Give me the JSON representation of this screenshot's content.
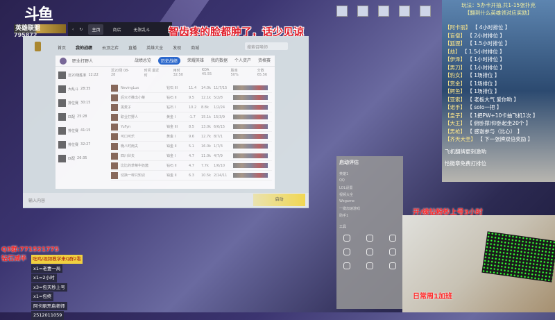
{
  "stream": {
    "platform_logo": "斗鱼",
    "game_banner": "英雄联盟",
    "room_id": "795872",
    "caption": "智齿疼的脸都肿了，话少见谅"
  },
  "client_topbar": {
    "tabs": [
      "主页",
      "商店",
      "无限乱斗"
    ]
  },
  "client": {
    "nav": [
      "首页",
      "我的战绩",
      "云顶之弈",
      "直播",
      "英雄大全",
      "发现",
      "商城"
    ],
    "search_placeholder": "搜索召唤师",
    "profile": {
      "name": "职业打野人",
      "tabs": [
        "战绩总览",
        "历史战绩",
        "荣耀英雄",
        "我的数据",
        "个人资产",
        "资格赛"
      ],
      "summary": [
        "近20场 08-28",
        "时间 最近时",
        "用时 32:50",
        "KDA 45.55",
        "胜率 50%",
        "分数 65.56"
      ],
      "left_list": [
        {
          "label": "近20场胜率",
          "time": "12:22"
        },
        {
          "label": "大乱斗",
          "time": "28:35"
        },
        {
          "label": "排位赛",
          "time": "30:15"
        },
        {
          "label": "匹配",
          "time": "25:28"
        },
        {
          "label": "排位赛",
          "time": "41:15"
        },
        {
          "label": "排位赛",
          "time": "32:27"
        },
        {
          "label": "匹配",
          "time": "26:35"
        }
      ],
      "rows": [
        {
          "name": "NevingLux",
          "rank": "钻石 III",
          "score": "11.4",
          "gold": "14.0k",
          "kda": "11/7/15"
        },
        {
          "name": "后只才推出小菜",
          "rank": "钻石 II",
          "score": "9.5",
          "gold": "12.1k",
          "kda": "5/2/8"
        },
        {
          "name": "黑麦子",
          "rank": "钻石 I",
          "score": "10.2",
          "gold": "8.8k",
          "kda": "1/2/24"
        },
        {
          "name": "职业打野人",
          "rank": "黄金 I",
          "score": "-1.7",
          "gold": "15.1k",
          "kda": "15/3/9"
        },
        {
          "name": "YuFyn",
          "rank": "铂金 III",
          "score": "8.5",
          "gold": "13.0k",
          "kda": "6/6/15"
        },
        {
          "name": "可口可乐",
          "rank": "黄金 I",
          "score": "9.6",
          "gold": "12.7k",
          "kda": "8/7/1"
        },
        {
          "name": "晚八时雨夫",
          "rank": "铂金 II",
          "score": "5.1",
          "gold": "16.0k",
          "kda": "1/7/3"
        },
        {
          "name": "四川伙夫",
          "rank": "铂金 I",
          "score": "4.7",
          "gold": "11.0k",
          "kda": "4/7/9"
        },
        {
          "name": "比比的草莓牛奶酱",
          "rank": "钻石 II",
          "score": "4.7",
          "gold": "7.7k",
          "kda": "1/6/10"
        },
        {
          "name": "切换一秤只知识",
          "rank": "铂金 II",
          "score": "6.3",
          "gold": "10.5k",
          "kda": "2/14/11"
        }
      ]
    },
    "chat_placeholder": "输入内容",
    "start_button": "启动"
  },
  "overlay": {
    "title": "玩法：5办卡开抽,共1-15张扑克",
    "subtitle": "【翻到什么英雄领对应奖励】",
    "rewards": [
      [
        "阿卡丽",
        "4小时排位"
      ],
      [
        "盲僧",
        "2小时排位"
      ],
      [
        "狐狸",
        "1.5小时排位"
      ],
      [
        "劫",
        "1.5小时排位"
      ],
      [
        "伊泽",
        "1小时排位"
      ],
      [
        "男刀",
        "1小时排位"
      ],
      [
        "豹女",
        "1场排位"
      ],
      [
        "赏金",
        "1场排位"
      ],
      [
        "鳄鱼",
        "1场排位"
      ],
      [
        "亚索",
        "老板大气 爱你哟"
      ],
      [
        "诺手",
        "solo一把"
      ],
      [
        "皇子",
        "1把PW+10卡抽飞机1次"
      ],
      [
        "大王",
        "俯卧撑/仰卧起坐20个"
      ],
      [
        "男枪",
        "感谢参与（比心）"
      ],
      [
        "齐天大圣",
        "下一张牌双倍奖励"
      ]
    ],
    "notes": [
      "飞机翻牌更刺激哟",
      "恰徽章免费打排位"
    ]
  },
  "promo": {
    "qq": "Q3群:771521775",
    "discount": "钻石减半",
    "gift_header": "吃鸡/视频教学来Q群2看",
    "gifts": [
      "x1=老妻一局",
      "x1=2小时",
      "x3=包天秒上号",
      "x1=包终",
      "阿卡丽开启老师",
      "2512011059"
    ]
  },
  "wegame": {
    "title": "启动评估",
    "items": [
      "英雄1",
      "QQ",
      "LOL设置",
      "视频大全",
      "Wegame",
      "一键加速游戏",
      "助手1"
    ],
    "tools_label": "工具"
  },
  "camera": {
    "caption_top": "开/续钻粉秒上号3小时",
    "caption_bottom": "日常周1加班"
  }
}
